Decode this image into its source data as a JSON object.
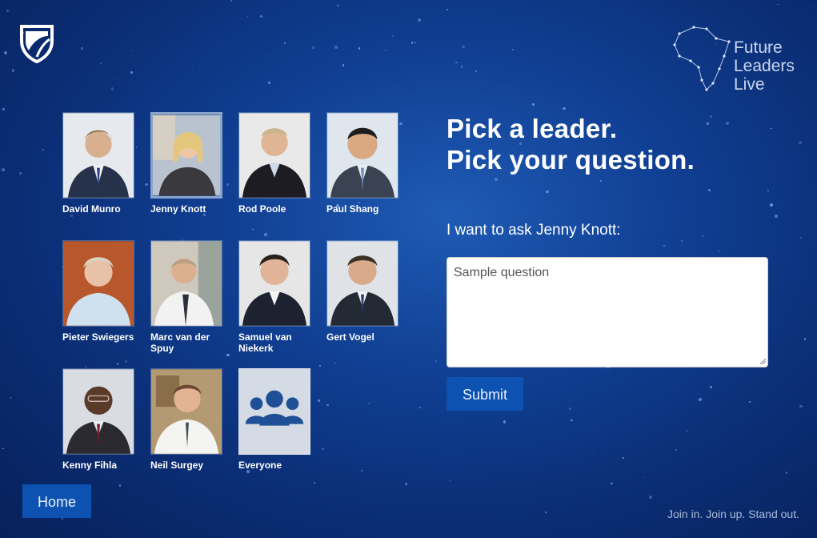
{
  "brand": {
    "logo_icon": "shield-icon"
  },
  "event_logo": {
    "icon": "africa-constellation-icon",
    "lines": [
      "Future",
      "Leaders",
      "Live"
    ]
  },
  "leaders": [
    {
      "name": "David Munro",
      "selected": false
    },
    {
      "name": "Jenny Knott",
      "selected": true
    },
    {
      "name": "Rod Poole",
      "selected": false
    },
    {
      "name": "Paul Shang",
      "selected": false
    },
    {
      "name": "Pieter Swiegers",
      "selected": false
    },
    {
      "name": "Marc van der Spuy",
      "selected": false
    },
    {
      "name": "Samuel van Niekerk",
      "selected": false
    },
    {
      "name": "Gert Vogel",
      "selected": false
    },
    {
      "name": "Kenny Fihla",
      "selected": false
    },
    {
      "name": "Neil Surgey",
      "selected": false
    },
    {
      "name": "Everyone",
      "selected": false,
      "icon": "group-icon"
    }
  ],
  "main": {
    "heading_line1": "Pick a leader.",
    "heading_line2": "Pick your question.",
    "ask_label": "I want to ask Jenny Knott:",
    "question_value": "Sample question",
    "submit_label": "Submit"
  },
  "footer": {
    "home_label": "Home",
    "tagline": "Join in. Join up. Stand out."
  },
  "colors": {
    "background": "#0a2c72",
    "button": "#0d52b0",
    "accent_border": "#8ba4c9"
  }
}
